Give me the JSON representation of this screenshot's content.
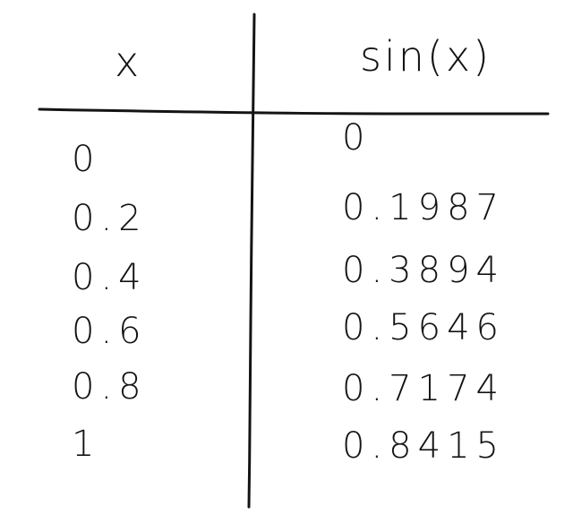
{
  "table": {
    "headers": {
      "x": "x",
      "sin": "sin(x)"
    },
    "rows": [
      {
        "x": "0",
        "sin": "0"
      },
      {
        "x": "0.2",
        "sin": "0.1987"
      },
      {
        "x": "0.4",
        "sin": "0.3894"
      },
      {
        "x": "0.6",
        "sin": "0.5646"
      },
      {
        "x": "0.8",
        "sin": "0.7174"
      },
      {
        "x": "1",
        "sin": "0.8415"
      }
    ]
  }
}
